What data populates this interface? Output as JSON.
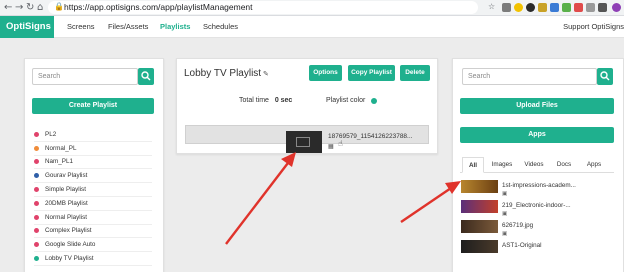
{
  "browser": {
    "url": "https://app.optisigns.com/app/playlistManagement",
    "back": "←",
    "forward": "→",
    "reload": "↻",
    "home": "⌂",
    "star": "☆"
  },
  "app": {
    "brand": "OptiSigns",
    "nav": [
      "Screens",
      "Files/Assets",
      "Playlists",
      "Schedules"
    ],
    "active_nav": "Playlists",
    "support": "Support OptiSigns",
    "accent": "#1fb08e"
  },
  "left_panel": {
    "search_placeholder": "Search",
    "create_button": "Create Playlist",
    "playlists": [
      {
        "name": "PL2",
        "color": "#e0436b"
      },
      {
        "name": "Normal_PL",
        "color": "#f08c3a"
      },
      {
        "name": "Nam_PL1",
        "color": "#e0436b"
      },
      {
        "name": "Gourav Playlist",
        "color": "#2f5fa8"
      },
      {
        "name": "Simple Playlist",
        "color": "#e0436b"
      },
      {
        "name": "20DMB Playlist",
        "color": "#e0436b"
      },
      {
        "name": "Normal Playlist",
        "color": "#e0436b"
      },
      {
        "name": "Complex Playlist",
        "color": "#e0436b"
      },
      {
        "name": "Google Slide Auto",
        "color": "#e0436b"
      },
      {
        "name": "Lobby TV Playlist",
        "color": "#1fb08e"
      }
    ]
  },
  "center_panel": {
    "title": "Lobby TV Playlist",
    "buttons": {
      "options": "Options",
      "copy": "Copy Playlist",
      "delete": "Delete"
    },
    "total_time_label": "Total time",
    "total_time_value": "0 sec",
    "playlist_color_label": "Playlist color",
    "playlist_color": "#1fb08e",
    "item": {
      "name": "18769579_1154126223788..."
    }
  },
  "right_panel": {
    "search_placeholder": "Search",
    "upload_button": "Upload Files",
    "apps_button": "Apps",
    "tabs": [
      "All",
      "Images",
      "Videos",
      "Docs",
      "Apps"
    ],
    "active_tab": "All",
    "assets": [
      {
        "name": "1st-impressions-academ..."
      },
      {
        "name": "219_Electronic-indoor-..."
      },
      {
        "name": "626719.jpg"
      },
      {
        "name": "AST1-Original"
      }
    ]
  },
  "annotation": {
    "arrow_color": "#e0332b"
  }
}
